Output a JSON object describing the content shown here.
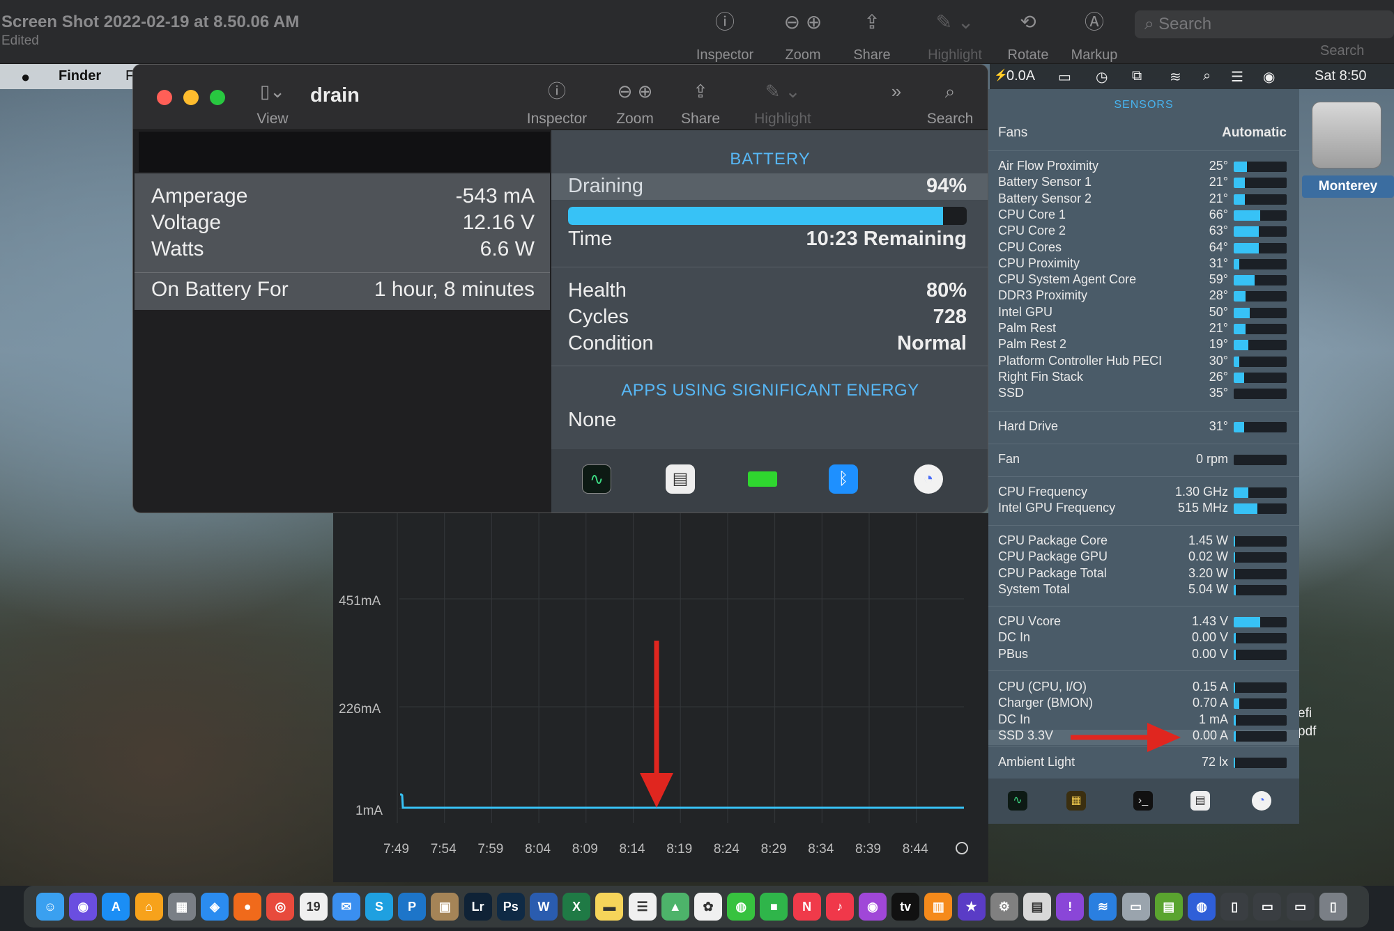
{
  "outer_window": {
    "title": "Screen Shot 2022-02-19 at 8.50.06 AM",
    "subtitle": "Edited",
    "toolbar": {
      "inspector": "Inspector",
      "zoom": "Zoom",
      "share": "Share",
      "highlight": "Highlight",
      "rotate": "Rotate",
      "markup": "Markup",
      "search_placeholder": "Search",
      "search_label": "Search"
    }
  },
  "menubar": {
    "app_name": "Finder",
    "truncated_menu": "F",
    "current_readout": "0.0A",
    "clock": "Sat 8:50"
  },
  "inner_window": {
    "title": "drain",
    "toolbar": {
      "view": "View",
      "inspector": "Inspector",
      "zoom": "Zoom",
      "share": "Share",
      "highlight": "Highlight",
      "search": "Search"
    }
  },
  "power": {
    "rows": [
      {
        "label": "Amperage",
        "value": "-543 mA"
      },
      {
        "label": "Voltage",
        "value": "12.16 V"
      },
      {
        "label": "Watts",
        "value": "6.6 W"
      }
    ],
    "on_battery_label": "On Battery For",
    "on_battery_value": "1 hour, 8 minutes"
  },
  "battery": {
    "title": "BATTERY",
    "state_label": "Draining",
    "percent": "94%",
    "level_fraction": 0.94,
    "time_label": "Time",
    "time_value": "10:23 Remaining",
    "health_label": "Health",
    "health_value": "80%",
    "cycles_label": "Cycles",
    "cycles_value": "728",
    "condition_label": "Condition",
    "condition_value": "Normal",
    "apps_title": "APPS USING SIGNIFICANT ENERGY",
    "apps_value": "None",
    "icons": [
      "activity-monitor-icon",
      "istat-icon",
      "battery-icon",
      "bluetooth-icon",
      "speedometer-icon"
    ]
  },
  "sensors": {
    "title": "SENSORS",
    "fans_label": "Fans",
    "fans_value": "Automatic",
    "temperatures": [
      {
        "label": "Air Flow Proximity",
        "value": "25°",
        "fill": 0.25
      },
      {
        "label": "Battery Sensor 1",
        "value": "21°",
        "fill": 0.21
      },
      {
        "label": "Battery Sensor 2",
        "value": "21°",
        "fill": 0.21
      },
      {
        "label": "CPU Core 1",
        "value": "66°",
        "fill": 0.5
      },
      {
        "label": "CPU Core 2",
        "value": "63°",
        "fill": 0.48
      },
      {
        "label": "CPU Cores",
        "value": "64°",
        "fill": 0.48
      },
      {
        "label": "CPU Proximity",
        "value": "31°",
        "fill": 0.1
      },
      {
        "label": "CPU System Agent Core",
        "value": "59°",
        "fill": 0.4
      },
      {
        "label": "DDR3 Proximity",
        "value": "28°",
        "fill": 0.22
      },
      {
        "label": "Intel GPU",
        "value": "50°",
        "fill": 0.3
      },
      {
        "label": "Palm Rest",
        "value": "21°",
        "fill": 0.22
      },
      {
        "label": "Palm Rest 2",
        "value": "19°",
        "fill": 0.27
      },
      {
        "label": "Platform Controller Hub PECI",
        "value": "30°",
        "fill": 0.1
      },
      {
        "label": "Right Fin Stack",
        "value": "26°",
        "fill": 0.2
      },
      {
        "label": "SSD",
        "value": "35°",
        "fill": 0.0
      }
    ],
    "hard_drive": {
      "label": "Hard Drive",
      "value": "31°",
      "fill": 0.2
    },
    "fan": {
      "label": "Fan",
      "value": "0 rpm",
      "fill": 0.0
    },
    "frequencies": [
      {
        "label": "CPU Frequency",
        "value": "1.30 GHz",
        "fill": 0.27
      },
      {
        "label": "Intel GPU Frequency",
        "value": "515 MHz",
        "fill": 0.45
      }
    ],
    "power": [
      {
        "label": "CPU Package Core",
        "value": "1.45 W",
        "fill": 0.03
      },
      {
        "label": "CPU Package GPU",
        "value": "0.02 W",
        "fill": 0.02
      },
      {
        "label": "CPU Package Total",
        "value": "3.20 W",
        "fill": 0.03
      },
      {
        "label": "System Total",
        "value": "5.04 W",
        "fill": 0.04
      }
    ],
    "voltages": [
      {
        "label": "CPU Vcore",
        "value": "1.43 V",
        "fill": 0.5
      },
      {
        "label": "DC In",
        "value": "0.00 V",
        "fill": 0.0
      },
      {
        "label": "PBus",
        "value": "0.00 V",
        "fill": 0.0
      }
    ],
    "currents": [
      {
        "label": "CPU (CPU, I/O)",
        "value": "0.15 A",
        "fill": 0.03
      },
      {
        "label": "Charger (BMON)",
        "value": "0.70 A",
        "fill": 0.1
      },
      {
        "label": "DC In",
        "value": "1 mA",
        "fill": 0.0
      },
      {
        "label": "SSD 3.3V",
        "value": "0.00 A",
        "fill": 0.0
      }
    ],
    "ambient": {
      "label": "Ambient Light",
      "value": "72 lx",
      "fill": 0.02
    }
  },
  "desktop": {
    "disk_label": "Monterey",
    "file_label_line1": "efi",
    "file_label_line2": "pdf"
  },
  "graph": {
    "y_labels": [
      "451mA",
      "226mA",
      "1mA"
    ],
    "x_labels": [
      "7:49",
      "7:54",
      "7:59",
      "8:04",
      "8:09",
      "8:14",
      "8:19",
      "8:24",
      "8:29",
      "8:34",
      "8:39",
      "8:44"
    ]
  },
  "colors": {
    "accent": "#37c2f6",
    "arrow": "#e0261f",
    "close": "#ff5f57",
    "minimize": "#febc2e",
    "zoom": "#28c840"
  }
}
